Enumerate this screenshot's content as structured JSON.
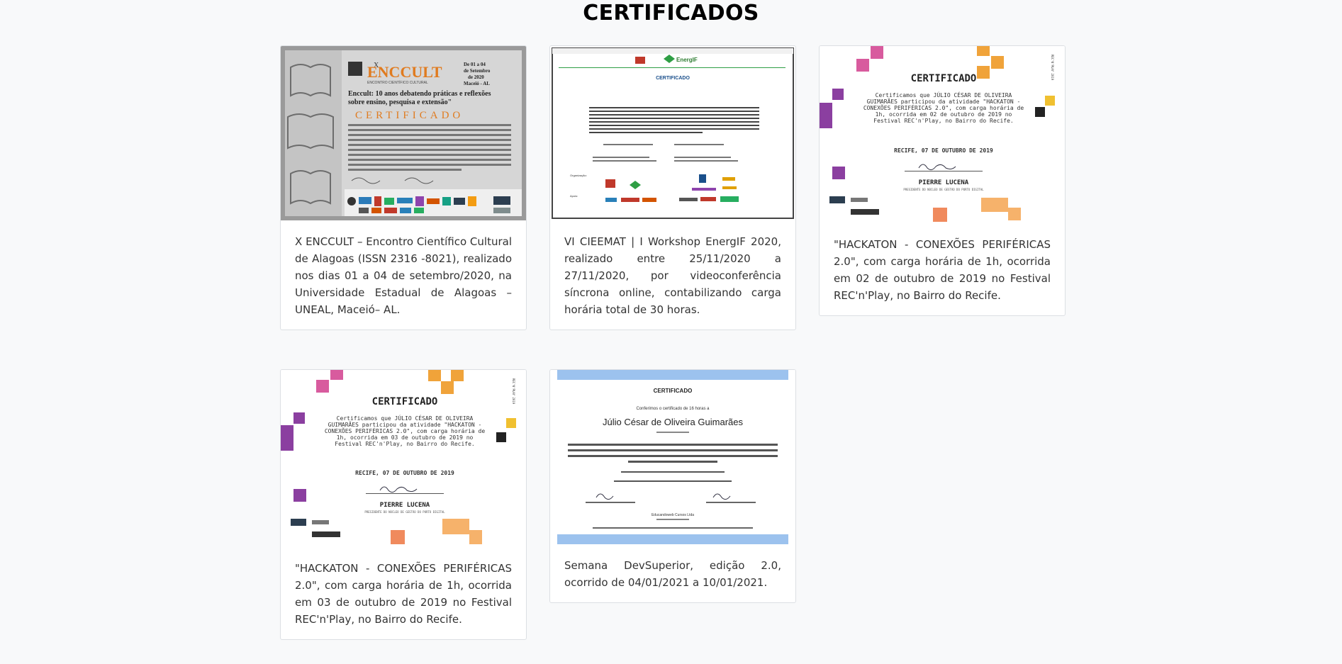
{
  "page": {
    "title": "CERTIFICADOS"
  },
  "certificates": [
    {
      "description": "X ENCCULT – Encontro Científico Cultural de Alagoas (ISSN 2316 -8021), realizado nos dias 01 a 04 de setembro/2020, na Universidade Estadual de Alagoas – UNEAL, Maceió– AL.",
      "image": {
        "brand": "ENCCULT",
        "brand_prefix": "X",
        "subtitle": "ENCONTRO CIENTÍFICO CULTURAL",
        "dates": "De 01 a 04 de Setembro de 2020 Maceió - AL",
        "headline": "Enccult: 10 anos debatendo práticas e reflexões sobre ensino, pesquisa e extensão",
        "heading": "CERTIFICADO"
      }
    },
    {
      "description": "VI CIEEMAT | I Workshop EnergIF 2020, realizado entre 25/11/2020 a 27/11/2020, por videoconferência síncrona online, contabilizando carga horária total de 30 horas.",
      "image": {
        "heading": "CERTIFICADO",
        "logo": "EnergIF",
        "org_label": "Organização:",
        "support_label": "Apoio:"
      }
    },
    {
      "description": "\"HACKATON - CONEXÕES PERIFÉRICAS 2.0\", com carga horária de 1h, ocorrida em 02 de outubro de 2019 no Festival REC'n'Play, no Bairro do Recife.",
      "image": {
        "heading": "CERTIFICADO",
        "body": "Certificamos que JÚLIO CÉSAR DE OLIVEIRA GUIMARÃES participou da atividade \"HACKATON - CONEXÕES PERIFÉRICAS 2.0\", com carga horária de 1h, ocorrida em 02 de outubro de 2019 no Festival REC'n'Play, no Bairro do Recife.",
        "date": "RECIFE, 07 DE OUTUBRO DE 2019",
        "signer": "PIERRE LUCENA",
        "signer_role": "PRESIDENTE DO NÚCLEO DE GESTÃO DO PORTO DIGITAL",
        "side": "REC'N'PLAY 2019"
      }
    },
    {
      "description": "\"HACKATON - CONEXÕES PERIFÉRICAS 2.0\", com carga horária de 1h, ocorrida em 03 de outubro de 2019 no Festival REC'n'Play, no Bairro do Recife.",
      "image": {
        "heading": "CERTIFICADO",
        "body": "Certificamos que JÚLIO CÉSAR DE OLIVEIRA GUIMARÃES participou da atividade \"HACKATON - CONEXÕES PERIFÉRICAS 2.0\", com carga horária de 1h, ocorrida em 03 de outubro de 2019 no Festival REC'n'Play, no Bairro do Recife.",
        "date": "RECIFE, 07 DE OUTUBRO DE 2019",
        "signer": "PIERRE LUCENA",
        "signer_role": "PRESIDENTE DO NÚCLEO DE GESTÃO DO PORTO DIGITAL",
        "side": "REC'N'PLAY 2019"
      }
    },
    {
      "description": "Semana DevSuperior, edição 2.0, ocorrido de 04/01/2021 a 10/01/2021.",
      "image": {
        "heading": "CERTIFICADO",
        "intro": "Conferimos o certificado de 16 horas a",
        "name": "Júlio César de Oliveira Guimarães",
        "company": "Educandoweb Cursos Ltda"
      }
    }
  ]
}
